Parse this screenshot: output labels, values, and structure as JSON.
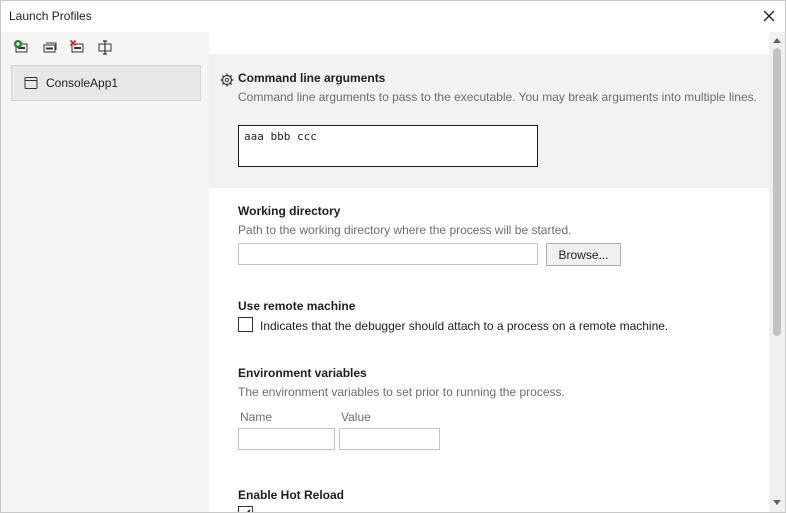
{
  "window": {
    "title": "Launch Profiles"
  },
  "toolbar": {
    "icons": [
      "new-profile-icon",
      "duplicate-profile-icon",
      "delete-profile-icon",
      "rename-profile-icon"
    ]
  },
  "profiles": [
    {
      "label": "ConsoleApp1"
    }
  ],
  "command_line": {
    "heading": "Command line arguments",
    "description": "Command line arguments to pass to the executable. You may break arguments into multiple lines.",
    "value": "aaa bbb ccc"
  },
  "working_directory": {
    "heading": "Working directory",
    "description": "Path to the working directory where the process will be started.",
    "value": "",
    "browse_label": "Browse..."
  },
  "remote_machine": {
    "heading": "Use remote machine",
    "checkbox_label": "Indicates that the debugger should attach to a process on a remote machine.",
    "checked": false
  },
  "environment": {
    "heading": "Environment variables",
    "description": "The environment variables to set prior to running the process.",
    "name_label": "Name",
    "value_label": "Value"
  },
  "hot_reload": {
    "heading": "Enable Hot Reload",
    "checked": true
  }
}
